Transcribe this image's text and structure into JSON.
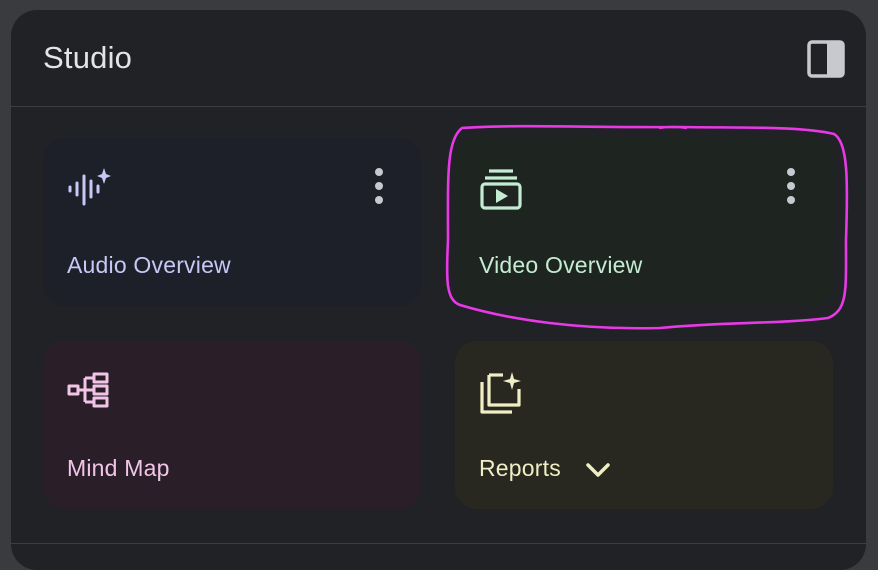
{
  "studio": {
    "title": "Studio"
  },
  "cards": {
    "audio": {
      "label": "Audio Overview",
      "color": "#c6c8f6",
      "bg": "#1e2029"
    },
    "video": {
      "label": "Video Overview",
      "color": "#c4ecd2",
      "bg": "#1e2420"
    },
    "mindmap": {
      "label": "Mind Map",
      "color": "#f2c5e8",
      "bg": "#2a1f29"
    },
    "reports": {
      "label": "Reports",
      "color": "#f0eec4",
      "bg": "#282820"
    }
  },
  "annotation": {
    "color": "#e73ae6"
  }
}
